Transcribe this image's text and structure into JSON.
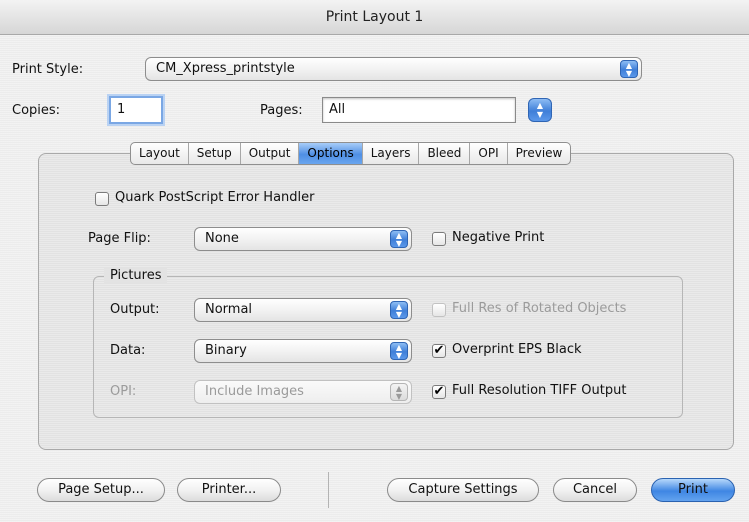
{
  "window": {
    "title": "Print Layout 1"
  },
  "print_style": {
    "label": "Print Style:",
    "value": "CM_Xpress_printstyle"
  },
  "copies": {
    "label": "Copies:",
    "value": "1"
  },
  "pages": {
    "label": "Pages:",
    "value": "All"
  },
  "tabs": [
    {
      "label": "Layout",
      "active": false
    },
    {
      "label": "Setup",
      "active": false
    },
    {
      "label": "Output",
      "active": false
    },
    {
      "label": "Options",
      "active": true
    },
    {
      "label": "Layers",
      "active": false
    },
    {
      "label": "Bleed",
      "active": false
    },
    {
      "label": "OPI",
      "active": false
    },
    {
      "label": "Preview",
      "active": false
    }
  ],
  "options": {
    "postscript_error_handler": {
      "label": "Quark PostScript Error Handler",
      "checked": false
    },
    "page_flip": {
      "label": "Page Flip:",
      "value": "None"
    },
    "negative_print": {
      "label": "Negative Print",
      "checked": false
    },
    "pictures": {
      "group_label": "Pictures",
      "output": {
        "label": "Output:",
        "value": "Normal"
      },
      "data": {
        "label": "Data:",
        "value": "Binary"
      },
      "opi": {
        "label": "OPI:",
        "value": "Include Images",
        "disabled": true
      },
      "full_res_rotated": {
        "label": "Full Res of Rotated Objects",
        "checked": false,
        "disabled": true
      },
      "overprint_eps_black": {
        "label": "Overprint EPS Black",
        "checked": true
      },
      "full_res_tiff": {
        "label": "Full Resolution TIFF Output",
        "checked": true
      }
    }
  },
  "buttons": {
    "page_setup": "Page Setup...",
    "printer": "Printer...",
    "capture_settings": "Capture Settings",
    "cancel": "Cancel",
    "print": "Print"
  },
  "glyphs": {
    "checkmark": "✔",
    "popup_arrows": "▲▼"
  }
}
